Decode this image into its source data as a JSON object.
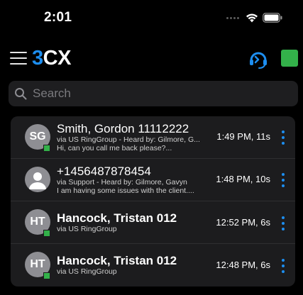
{
  "status_bar": {
    "time": "2:01"
  },
  "header": {
    "logo_number": "3",
    "logo_text": "CX"
  },
  "search": {
    "placeholder": "Search",
    "value": ""
  },
  "colors": {
    "accent": "#1d8ef0",
    "presence_available": "#33b14a",
    "background": "#000000",
    "card": "#1c1c1e"
  },
  "calls": [
    {
      "initials": "SG",
      "name": "Smith, Gordon 11112222",
      "line1": "via US RingGroup - Heard by: Gilmore, G...",
      "line2": "Hi, can you call me back please?...",
      "time": "1:49 PM, 11s",
      "avatar_type": "initials",
      "presence": "available"
    },
    {
      "initials": "",
      "name": "+1456487878454",
      "line1": "via Support - Heard by: Gilmore, Gavyn",
      "line2": "I am having some issues with the client....",
      "time": "1:48 PM, 10s",
      "avatar_type": "person-icon",
      "presence": "none"
    },
    {
      "initials": "HT",
      "name": "Hancock, Tristan 012",
      "line1": "via US RingGroup",
      "line2": "",
      "time": "12:52 PM, 6s",
      "avatar_type": "initials",
      "presence": "available"
    },
    {
      "initials": "HT",
      "name": "Hancock, Tristan 012",
      "line1": "via US RingGroup",
      "line2": "",
      "time": "12:48 PM, 6s",
      "avatar_type": "initials",
      "presence": "available"
    }
  ]
}
